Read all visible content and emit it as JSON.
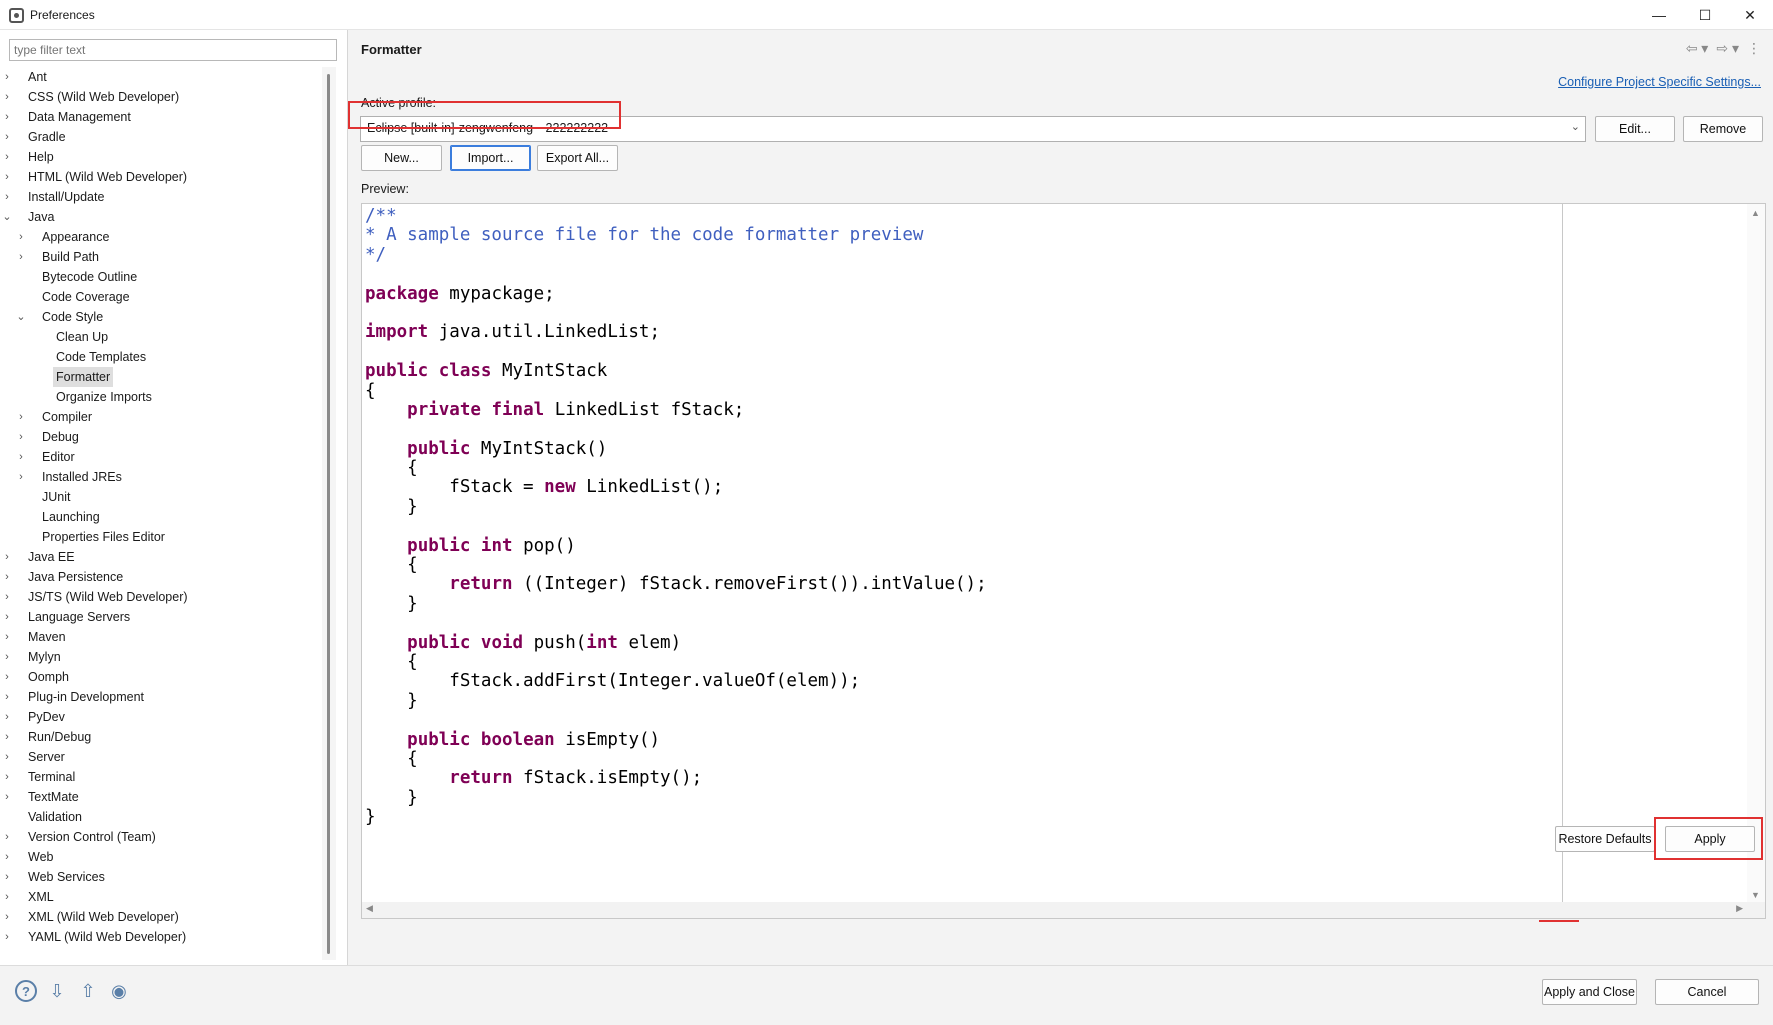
{
  "window": {
    "title": "Preferences",
    "minimize": "—",
    "maximize": "☐",
    "close": "✕"
  },
  "filter": {
    "placeholder": "type filter text"
  },
  "tree": [
    {
      "label": "Ant",
      "level": 0,
      "expander": "›"
    },
    {
      "label": "CSS (Wild Web Developer)",
      "level": 0,
      "expander": "›"
    },
    {
      "label": "Data Management",
      "level": 0,
      "expander": "›"
    },
    {
      "label": "Gradle",
      "level": 0,
      "expander": "›"
    },
    {
      "label": "Help",
      "level": 0,
      "expander": "›"
    },
    {
      "label": "HTML (Wild Web Developer)",
      "level": 0,
      "expander": "›"
    },
    {
      "label": "Install/Update",
      "level": 0,
      "expander": "›"
    },
    {
      "label": "Java",
      "level": 0,
      "expander": "⌄"
    },
    {
      "label": "Appearance",
      "level": 1,
      "expander": "›"
    },
    {
      "label": "Build Path",
      "level": 1,
      "expander": "›"
    },
    {
      "label": "Bytecode Outline",
      "level": 1,
      "expander": ""
    },
    {
      "label": "Code Coverage",
      "level": 1,
      "expander": ""
    },
    {
      "label": "Code Style",
      "level": 1,
      "expander": "⌄"
    },
    {
      "label": "Clean Up",
      "level": 2,
      "expander": ""
    },
    {
      "label": "Code Templates",
      "level": 2,
      "expander": ""
    },
    {
      "label": "Formatter",
      "level": 2,
      "expander": "",
      "selected": true
    },
    {
      "label": "Organize Imports",
      "level": 2,
      "expander": ""
    },
    {
      "label": "Compiler",
      "level": 1,
      "expander": "›"
    },
    {
      "label": "Debug",
      "level": 1,
      "expander": "›"
    },
    {
      "label": "Editor",
      "level": 1,
      "expander": "›"
    },
    {
      "label": "Installed JREs",
      "level": 1,
      "expander": "›"
    },
    {
      "label": "JUnit",
      "level": 1,
      "expander": ""
    },
    {
      "label": "Launching",
      "level": 1,
      "expander": ""
    },
    {
      "label": "Properties Files Editor",
      "level": 1,
      "expander": ""
    },
    {
      "label": "Java EE",
      "level": 0,
      "expander": "›"
    },
    {
      "label": "Java Persistence",
      "level": 0,
      "expander": "›"
    },
    {
      "label": "JS/TS (Wild Web Developer)",
      "level": 0,
      "expander": "›"
    },
    {
      "label": "Language Servers",
      "level": 0,
      "expander": "›"
    },
    {
      "label": "Maven",
      "level": 0,
      "expander": "›"
    },
    {
      "label": "Mylyn",
      "level": 0,
      "expander": "›"
    },
    {
      "label": "Oomph",
      "level": 0,
      "expander": "›"
    },
    {
      "label": "Plug-in Development",
      "level": 0,
      "expander": "›"
    },
    {
      "label": "PyDev",
      "level": 0,
      "expander": "›"
    },
    {
      "label": "Run/Debug",
      "level": 0,
      "expander": "›"
    },
    {
      "label": "Server",
      "level": 0,
      "expander": "›"
    },
    {
      "label": "Terminal",
      "level": 0,
      "expander": "›"
    },
    {
      "label": "TextMate",
      "level": 0,
      "expander": "›"
    },
    {
      "label": "Validation",
      "level": 0,
      "expander": ""
    },
    {
      "label": "Version Control (Team)",
      "level": 0,
      "expander": "›"
    },
    {
      "label": "Web",
      "level": 0,
      "expander": "›"
    },
    {
      "label": "Web Services",
      "level": 0,
      "expander": "›"
    },
    {
      "label": "XML",
      "level": 0,
      "expander": "›"
    },
    {
      "label": "XML (Wild Web Developer)",
      "level": 0,
      "expander": "›"
    },
    {
      "label": "YAML (Wild Web Developer)",
      "level": 0,
      "expander": "›"
    }
  ],
  "page": {
    "title": "Formatter",
    "nav_back": "⇦ ▾",
    "nav_forward": "⇨ ▾",
    "nav_menu": "⋮",
    "configure_link": "Configure Project Specific Settings...",
    "active_profile_label": "Active profile:",
    "active_profile_value": "Eclipse [built-in]-zengwenfeng---222222222",
    "edit_button": "Edit...",
    "remove_button": "Remove",
    "new_button": "New...",
    "import_button": "Import...",
    "export_button": "Export All...",
    "preview_label": "Preview:",
    "restore_defaults_button": "Restore Defaults",
    "apply_button": "Apply"
  },
  "code_lines": [
    [
      [
        "cm",
        "/**"
      ]
    ],
    [
      [
        "cm",
        "* A sample source file for the code formatter preview"
      ]
    ],
    [
      [
        "cm",
        "*/"
      ]
    ],
    [],
    [
      [
        "kw",
        "package"
      ],
      [
        "t",
        " mypackage;"
      ]
    ],
    [],
    [
      [
        "kw",
        "import"
      ],
      [
        "t",
        " java.util.LinkedList;"
      ]
    ],
    [],
    [
      [
        "kw",
        "public"
      ],
      [
        "t",
        " "
      ],
      [
        "kw",
        "class"
      ],
      [
        "t",
        " MyIntStack"
      ]
    ],
    [
      [
        "t",
        "{"
      ]
    ],
    [
      [
        "t",
        "    "
      ],
      [
        "kw",
        "private"
      ],
      [
        "t",
        " "
      ],
      [
        "kw",
        "final"
      ],
      [
        "t",
        " LinkedList fStack;"
      ]
    ],
    [],
    [
      [
        "t",
        "    "
      ],
      [
        "kw",
        "public"
      ],
      [
        "t",
        " MyIntStack()"
      ]
    ],
    [
      [
        "t",
        "    {"
      ]
    ],
    [
      [
        "t",
        "        fStack = "
      ],
      [
        "kw",
        "new"
      ],
      [
        "t",
        " LinkedList();"
      ]
    ],
    [
      [
        "t",
        "    }"
      ]
    ],
    [],
    [
      [
        "t",
        "    "
      ],
      [
        "kw",
        "public"
      ],
      [
        "t",
        " "
      ],
      [
        "kw",
        "int"
      ],
      [
        "t",
        " pop()"
      ]
    ],
    [
      [
        "t",
        "    {"
      ]
    ],
    [
      [
        "t",
        "        "
      ],
      [
        "kw",
        "return"
      ],
      [
        "t",
        " ((Integer) fStack.removeFirst()).intValue();"
      ]
    ],
    [
      [
        "t",
        "    }"
      ]
    ],
    [],
    [
      [
        "t",
        "    "
      ],
      [
        "kw",
        "public"
      ],
      [
        "t",
        " "
      ],
      [
        "kw",
        "void"
      ],
      [
        "t",
        " push("
      ],
      [
        "kw",
        "int"
      ],
      [
        "t",
        " elem)"
      ]
    ],
    [
      [
        "t",
        "    {"
      ]
    ],
    [
      [
        "t",
        "        fStack.addFirst(Integer.valueOf(elem));"
      ]
    ],
    [
      [
        "t",
        "    }"
      ]
    ],
    [],
    [
      [
        "t",
        "    "
      ],
      [
        "kw",
        "public"
      ],
      [
        "t",
        " "
      ],
      [
        "kw",
        "boolean"
      ],
      [
        "t",
        " isEmpty()"
      ]
    ],
    [
      [
        "t",
        "    {"
      ]
    ],
    [
      [
        "t",
        "        "
      ],
      [
        "kw",
        "return"
      ],
      [
        "t",
        " fStack.isEmpty();"
      ]
    ],
    [
      [
        "t",
        "    }"
      ]
    ],
    [
      [
        "t",
        "}"
      ]
    ]
  ],
  "footer": {
    "help_icon": "?",
    "import_icon": "⇩",
    "export_icon": "⇧",
    "oomph_icon": "◉",
    "apply_close_button": "Apply and Close",
    "cancel_button": "Cancel"
  },
  "colors": {
    "keyword": "#7f0055",
    "comment": "#3f5fbf",
    "highlight_red": "#e03131",
    "link": "#1a5fb4"
  }
}
